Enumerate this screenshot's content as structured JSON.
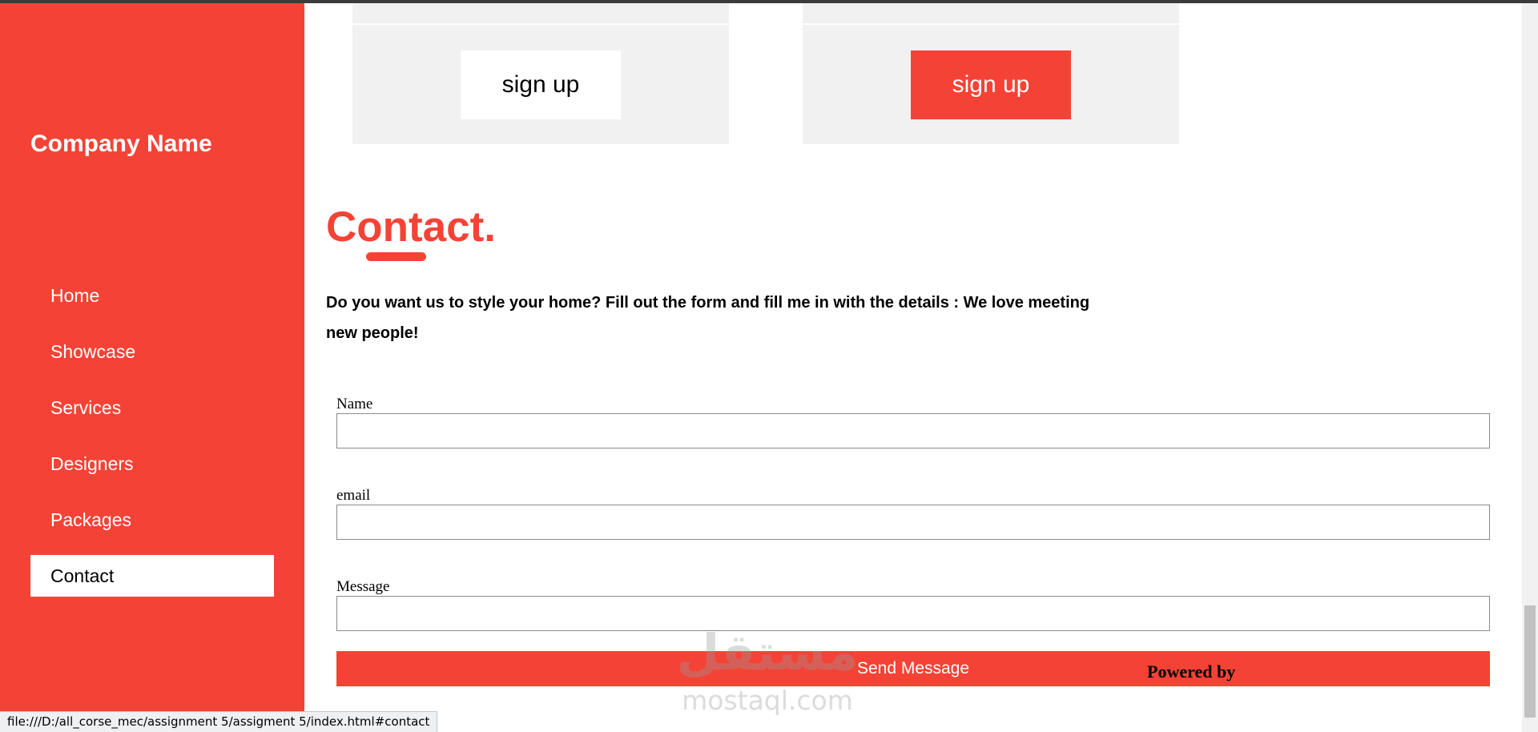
{
  "sidebar": {
    "company_name": "Company Name",
    "nav": [
      {
        "label": "Home",
        "active": false
      },
      {
        "label": "Showcase",
        "active": false
      },
      {
        "label": "Services",
        "active": false
      },
      {
        "label": "Designers",
        "active": false
      },
      {
        "label": "Packages",
        "active": false
      },
      {
        "label": "Contact",
        "active": true
      }
    ]
  },
  "packages": {
    "card1_button": "sign up",
    "card2_button": "sign up"
  },
  "contact": {
    "title": "Contact.",
    "description": "Do you want us to style your home? Fill out the form and fill me in with the details : We love meeting new people!",
    "form": {
      "name_label": "Name",
      "name_value": "",
      "email_label": "email",
      "email_value": "",
      "message_label": "Message",
      "message_value": "",
      "submit_label": "Send Message"
    }
  },
  "footer": {
    "powered_by": "Powered by"
  },
  "watermark": {
    "arabic": "مستقل",
    "latin": "mostaql.com"
  },
  "status_bar": {
    "url": "file:///D:/all_corse_mec/assignment 5/assigment 5/index.html#contact"
  },
  "colors": {
    "accent": "#f44336",
    "card_bg": "#f1f1f1"
  }
}
